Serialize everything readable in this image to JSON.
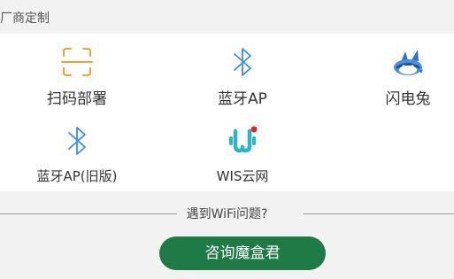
{
  "section": {
    "title": "厂商定制"
  },
  "vendors": [
    {
      "label": "扫码部署",
      "icon": "scan-qr-icon"
    },
    {
      "label": "蓝牙AP",
      "icon": "bluetooth-icon"
    },
    {
      "label": "闪电兔",
      "icon": "flash-rabbit-icon"
    },
    {
      "label": "蓝牙AP(旧版)",
      "icon": "bluetooth-icon"
    },
    {
      "label": "WIS云网",
      "icon": "wis-cloud-logo-icon"
    }
  ],
  "help": {
    "question": "遇到WiFi问题?",
    "button_label": "咨询魔盒君"
  },
  "colors": {
    "scan_icon": "#f0a03c",
    "bluetooth_icon": "#3a8fd6",
    "wis_logo": "#2bb5c6",
    "wis_dot": "#e0282e",
    "button": "#1f7a45"
  }
}
